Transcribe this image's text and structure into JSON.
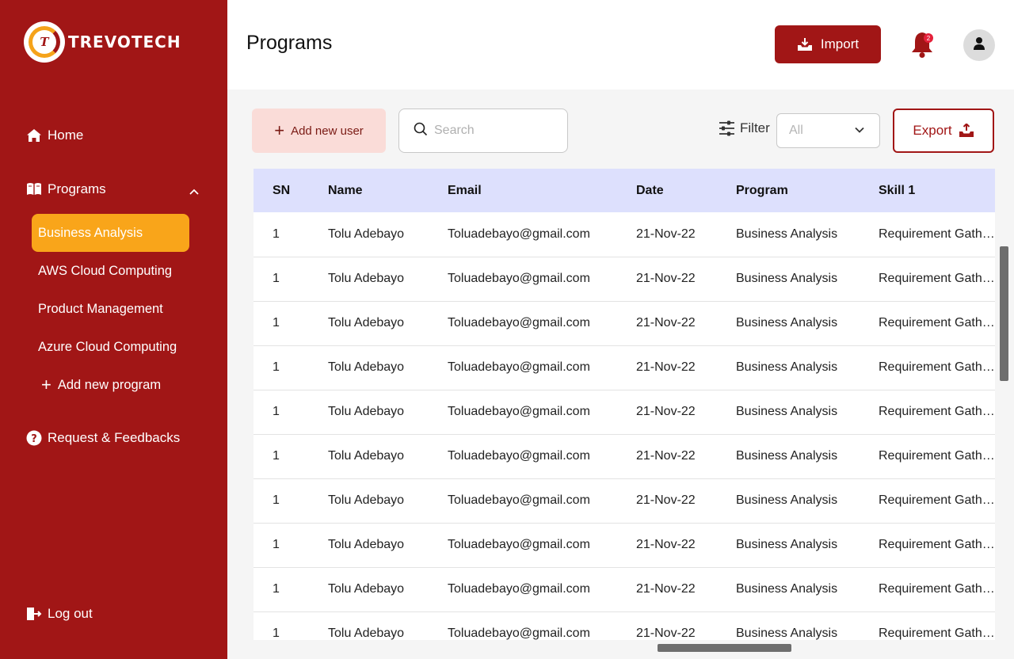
{
  "brand": {
    "name": "TREVOTECH",
    "mark": "T"
  },
  "sidebar": {
    "home": "Home",
    "programs": "Programs",
    "sub_items": [
      "Business Analysis",
      "AWS Cloud Computing",
      "Product Management",
      "Azure Cloud Computing"
    ],
    "active_sub_item": "Business Analysis",
    "add_program": "Add new program",
    "feedback": "Request & Feedbacks",
    "logout": "Log out"
  },
  "header": {
    "title": "Programs",
    "import_label": "Import",
    "notification_count": "2"
  },
  "toolbar": {
    "add_user_label": "Add new user",
    "search_placeholder": "Search",
    "filter_label": "Filter",
    "filter_value": "All",
    "export_label": "Export"
  },
  "table": {
    "columns": [
      "SN",
      "Name",
      "Email",
      "Date",
      "Program",
      "Skill 1"
    ],
    "rows": [
      [
        "1",
        "Tolu Adebayo",
        "Toluadebayo@gmail.com",
        "21-Nov-22",
        "Business Analysis",
        "Requirement Gathering"
      ],
      [
        "1",
        "Tolu Adebayo",
        "Toluadebayo@gmail.com",
        "21-Nov-22",
        "Business Analysis",
        "Requirement Gathering"
      ],
      [
        "1",
        "Tolu Adebayo",
        "Toluadebayo@gmail.com",
        "21-Nov-22",
        "Business Analysis",
        "Requirement Gathering"
      ],
      [
        "1",
        "Tolu Adebayo",
        "Toluadebayo@gmail.com",
        "21-Nov-22",
        "Business Analysis",
        "Requirement Gathering"
      ],
      [
        "1",
        "Tolu Adebayo",
        "Toluadebayo@gmail.com",
        "21-Nov-22",
        "Business Analysis",
        "Requirement Gathering"
      ],
      [
        "1",
        "Tolu Adebayo",
        "Toluadebayo@gmail.com",
        "21-Nov-22",
        "Business Analysis",
        "Requirement Gathering"
      ],
      [
        "1",
        "Tolu Adebayo",
        "Toluadebayo@gmail.com",
        "21-Nov-22",
        "Business Analysis",
        "Requirement Gathering"
      ],
      [
        "1",
        "Tolu Adebayo",
        "Toluadebayo@gmail.com",
        "21-Nov-22",
        "Business Analysis",
        "Requirement Gathering"
      ],
      [
        "1",
        "Tolu Adebayo",
        "Toluadebayo@gmail.com",
        "21-Nov-22",
        "Business Analysis",
        "Requirement Gathering"
      ],
      [
        "1",
        "Tolu Adebayo",
        "Toluadebayo@gmail.com",
        "21-Nov-22",
        "Business Analysis",
        "Requirement Gathering"
      ]
    ]
  },
  "colors": {
    "brand_red": "#a11616",
    "active_orange": "#f9a51a",
    "table_header": "#dde0fd",
    "add_user_bg": "#fadcd8",
    "badge": "#e5203a"
  },
  "icons": {
    "home": "home-icon",
    "programs": "book-icon",
    "feedback": "question-icon",
    "logout": "logout-icon",
    "import": "inbox-tray-icon",
    "bell": "bell-icon",
    "avatar": "user-icon",
    "search": "search-icon",
    "filter": "sliders-icon",
    "export": "export-tray-icon"
  }
}
